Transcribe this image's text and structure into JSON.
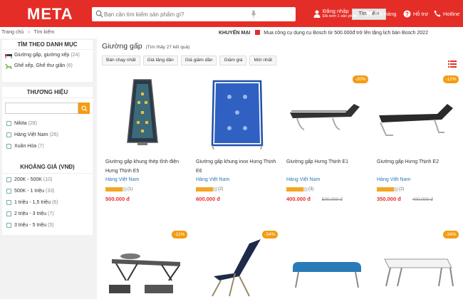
{
  "header": {
    "logo": "META",
    "search_placeholder": "Bạn cần tìm kiếm sản phẩm gì?",
    "search_button": "Tìm kiếm",
    "login_label": "Đăng nhập",
    "login_sub": "Đã xem 1 sản phẩm",
    "cart_label": "Giỏ hàng",
    "help_label": "Hỗ trợ",
    "hotline_label": "Hotline",
    "brand_color": "#e52d27"
  },
  "breadcrumb": {
    "home": "Trang chủ",
    "separator": "›",
    "current": "Tìm kiếm"
  },
  "promo": {
    "label": "KHUYẾN MẠI",
    "text": "Mua công cụ dụng cụ Bosch từ 500.000đ trở lên tặng lịch bàn Bosch 2022"
  },
  "sidebar": {
    "categories": {
      "title": "TÌM THEO DANH MỤC",
      "items": [
        {
          "label": "Giường gấp, giường xếp",
          "count": "(24)"
        },
        {
          "label": "Ghế xếp, Ghế thư giãn",
          "count": "(6)"
        }
      ]
    },
    "brands": {
      "title": "THƯƠNG HIỆU",
      "items": [
        {
          "label": "Nikita",
          "count": "(28)"
        },
        {
          "label": "Hàng Việt Nam",
          "count": "(26)"
        },
        {
          "label": "Xuân Hòa",
          "count": "(7)"
        }
      ]
    },
    "price": {
      "title": "KHOẢNG GIÁ (VNĐ)",
      "items": [
        {
          "label": "200K - 500K",
          "count": "(10)"
        },
        {
          "label": "500K - 1 triệu",
          "count": "(33)"
        },
        {
          "label": "1 triệu - 1,5 triệu",
          "count": "(6)"
        },
        {
          "label": "2 triệu - 3 triệu",
          "count": "(7)"
        },
        {
          "label": "3 triệu - 5 triệu",
          "count": "(5)"
        }
      ]
    }
  },
  "main": {
    "title": "Giường gấp",
    "result_count": "(Tìm thấy 27 kết quả)",
    "sorts": [
      "Bán chạy nhất",
      "Giá tăng dần",
      "Giá giảm dần",
      "Giảm giá",
      "Mới nhất"
    ],
    "products": [
      {
        "name": "Giường gấp khung thép tĩnh điện Hưng Thịnh E5",
        "seller": "Hàng Việt Nam",
        "rating": 4,
        "reviews": "(1)",
        "price": "500.000 đ",
        "old_price": "",
        "badge": ""
      },
      {
        "name": "Giường gấp khung inox Hưng Thịnh E6",
        "seller": "Hàng Việt Nam",
        "rating": 4,
        "reviews": "(2)",
        "price": "600.000 đ",
        "old_price": "",
        "badge": ""
      },
      {
        "name": "Giường gấp Hưng Thịnh E1",
        "seller": "Hàng Việt Nam",
        "rating": 4,
        "reviews": "(3)",
        "price": "400.000 đ",
        "old_price": "500.000 đ",
        "badge": "-20%"
      },
      {
        "name": "Giường gấp Hưng Thịnh E2",
        "seller": "Hàng Việt Nam",
        "rating": 4,
        "reviews": "(2)",
        "price": "350.000 đ",
        "old_price": "400.000 đ",
        "badge": "-12%"
      },
      {
        "badge": "-11%"
      },
      {
        "badge": "-54%"
      },
      {
        "badge": ""
      },
      {
        "badge": "-24%"
      }
    ]
  }
}
